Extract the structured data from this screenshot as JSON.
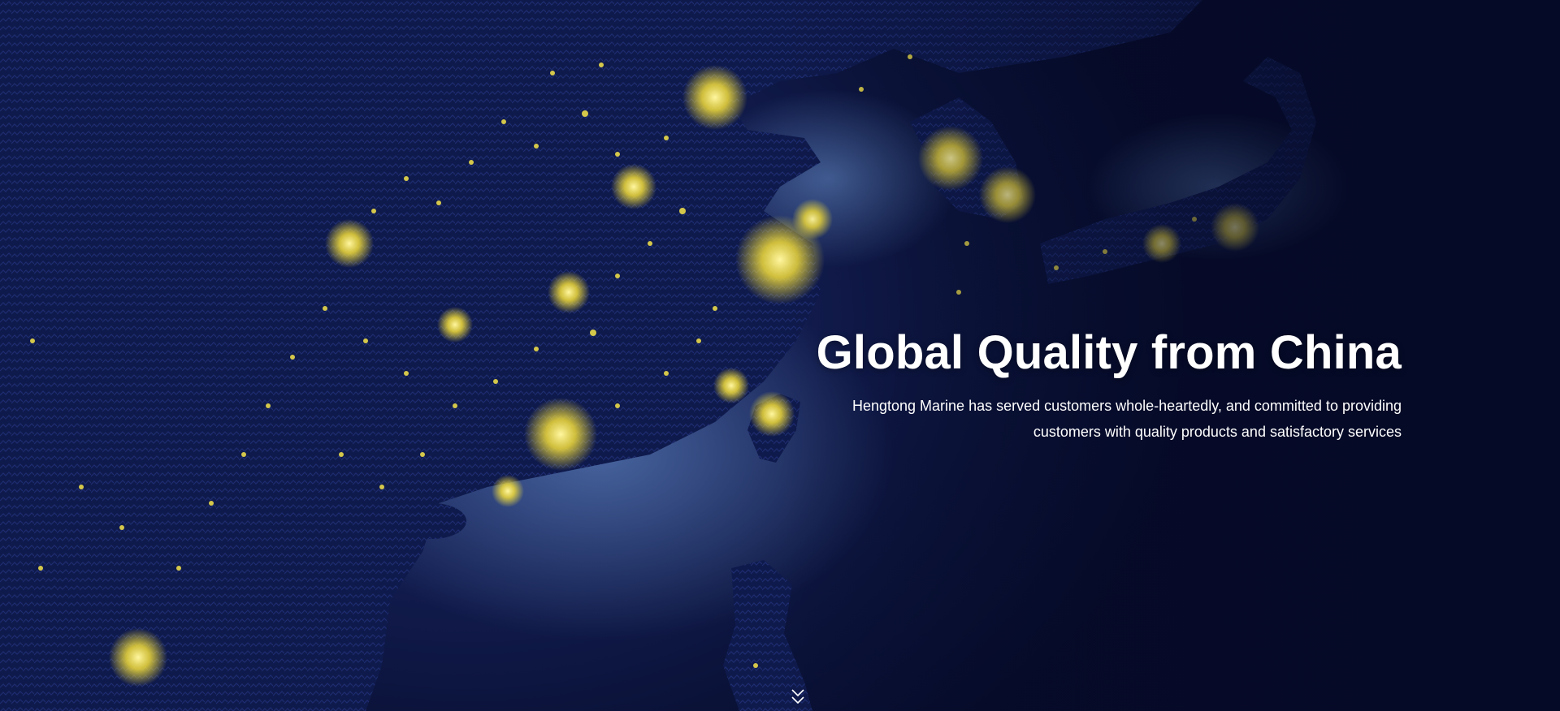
{
  "hero": {
    "headline": "Global Quality from China",
    "subline": "Hengtong Marine has served customers whole-heartedly, and committed to providing customers with quality products and satisfactory services",
    "background_image": "night satellite view of East Asia with city lights",
    "scroll_icon": "double-chevron-down-icon"
  },
  "colors": {
    "ocean_deep": "#050a26",
    "ocean_mid": "#121c4e",
    "shallow_sea": "#2f4a8a",
    "land": "#0d1642",
    "city_light": "#f7e64a",
    "text": "#ffffff"
  }
}
